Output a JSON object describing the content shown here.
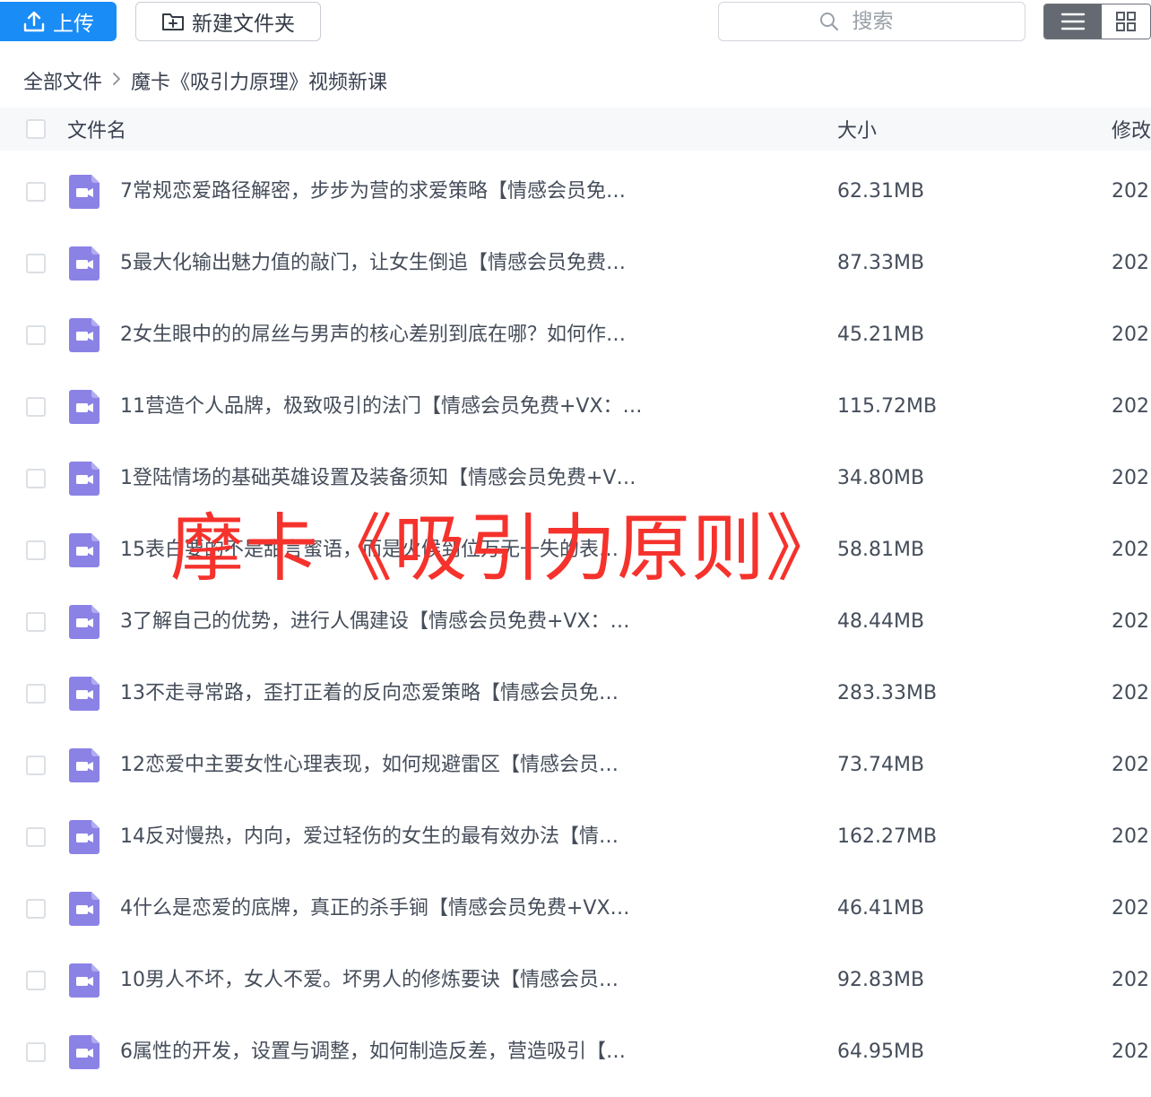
{
  "toolbar": {
    "upload_label": "上传",
    "new_folder_label": "新建文件夹",
    "search_placeholder": "搜索"
  },
  "breadcrumb": {
    "root": "全部文件",
    "current": "魔卡《吸引力原理》视频新课"
  },
  "columns": {
    "name": "文件名",
    "size": "大小",
    "modified": "修改"
  },
  "files": [
    {
      "name": "7常规恋爱路径解密，步步为营的求爱策略【情感会员免…",
      "size": "62.31MB",
      "date": "202"
    },
    {
      "name": "5最大化输出魅力值的敲门，让女生倒追【情感会员免费…",
      "size": "87.33MB",
      "date": "202"
    },
    {
      "name": "2女生眼中的的屌丝与男声的核心差别到底在哪？如何作…",
      "size": "45.21MB",
      "date": "202"
    },
    {
      "name": "11营造个人品牌，极致吸引的法门【情感会员免费+VX：…",
      "size": "115.72MB",
      "date": "202"
    },
    {
      "name": "1登陆情场的基础英雄设置及装备须知【情感会员免费+V…",
      "size": "34.80MB",
      "date": "202"
    },
    {
      "name": "15表白要的不是甜言蜜语，而是火候到位万无一失的表…",
      "size": "58.81MB",
      "date": "202"
    },
    {
      "name": "3了解自己的优势，进行人偶建设【情感会员免费+VX：…",
      "size": "48.44MB",
      "date": "202"
    },
    {
      "name": "13不走寻常路，歪打正着的反向恋爱策略【情感会员免…",
      "size": "283.33MB",
      "date": "202"
    },
    {
      "name": "12恋爱中主要女性心理表现，如何规避雷区【情感会员…",
      "size": "73.74MB",
      "date": "202"
    },
    {
      "name": "14反对慢热，内向，爱过轻伤的女生的最有效办法【情…",
      "size": "162.27MB",
      "date": "202"
    },
    {
      "name": "4什么是恋爱的底牌，真正的杀手锏【情感会员免费+VX…",
      "size": "46.41MB",
      "date": "202"
    },
    {
      "name": "10男人不坏，女人不爱。坏男人的修炼要诀【情感会员…",
      "size": "92.83MB",
      "date": "202"
    },
    {
      "name": "6属性的开发，设置与调整，如何制造反差，营造吸引【…",
      "size": "64.95MB",
      "date": "202"
    }
  ],
  "watermark": "摩卡《吸引力原则》",
  "colors": {
    "accent": "#1a8cf5",
    "video_icon": "#8b82e6",
    "watermark": "#f5322c"
  },
  "icons": {
    "upload": "upload-icon",
    "new_folder": "new-folder-icon",
    "search": "search-icon",
    "list_view": "list-view-icon",
    "grid_view": "grid-view-icon",
    "file": "video-file-icon"
  }
}
